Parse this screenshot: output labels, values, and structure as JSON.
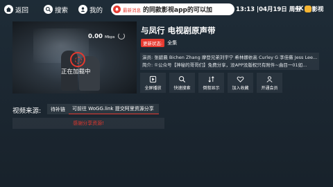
{
  "topbar": {
    "back_label": "返回",
    "search_label": "搜索",
    "mine_label": "我的",
    "news_tag": "最新消息",
    "news_text": "的同款影视app的可以加",
    "datetime": "13:13 |04月19日 周五",
    "brand": "4K",
    "brand_suffix": "影视"
  },
  "player": {
    "speed_value": "0.00",
    "speed_unit": "Mbps",
    "loading_text": "正在加载中"
  },
  "info": {
    "title": "与凤行 电视剧原声带",
    "status_label": "更新状态:",
    "status_value": "全集",
    "cast_line": "演员: 张碧晨 Bichen Zhang 摩登兄弟刘宇宁 希林娜依高 Curley G 李佳薇 Jess Lee...",
    "intro_line": "简介: ①公众号【神秘的哥哥们】免费分享，没APP没版权只有附件~曲目一01如..."
  },
  "actions": [
    {
      "label": "全屏播放",
      "icon": "fullscreen-icon"
    },
    {
      "label": "快速搜索",
      "icon": "search-icon"
    },
    {
      "label": "倒叙显示",
      "icon": "sort-icon"
    },
    {
      "label": "加入收藏",
      "icon": "heart-icon"
    },
    {
      "label": "开通会员",
      "icon": "vip-icon"
    }
  ],
  "sources": {
    "label": "视频来源:",
    "items": [
      "待补链",
      "可前往 WoGG.link 提交阿里资源分享"
    ],
    "thanks": "感谢分享资源!"
  },
  "colors": {
    "accent": "#e5392f",
    "background": "#1e2c37"
  }
}
